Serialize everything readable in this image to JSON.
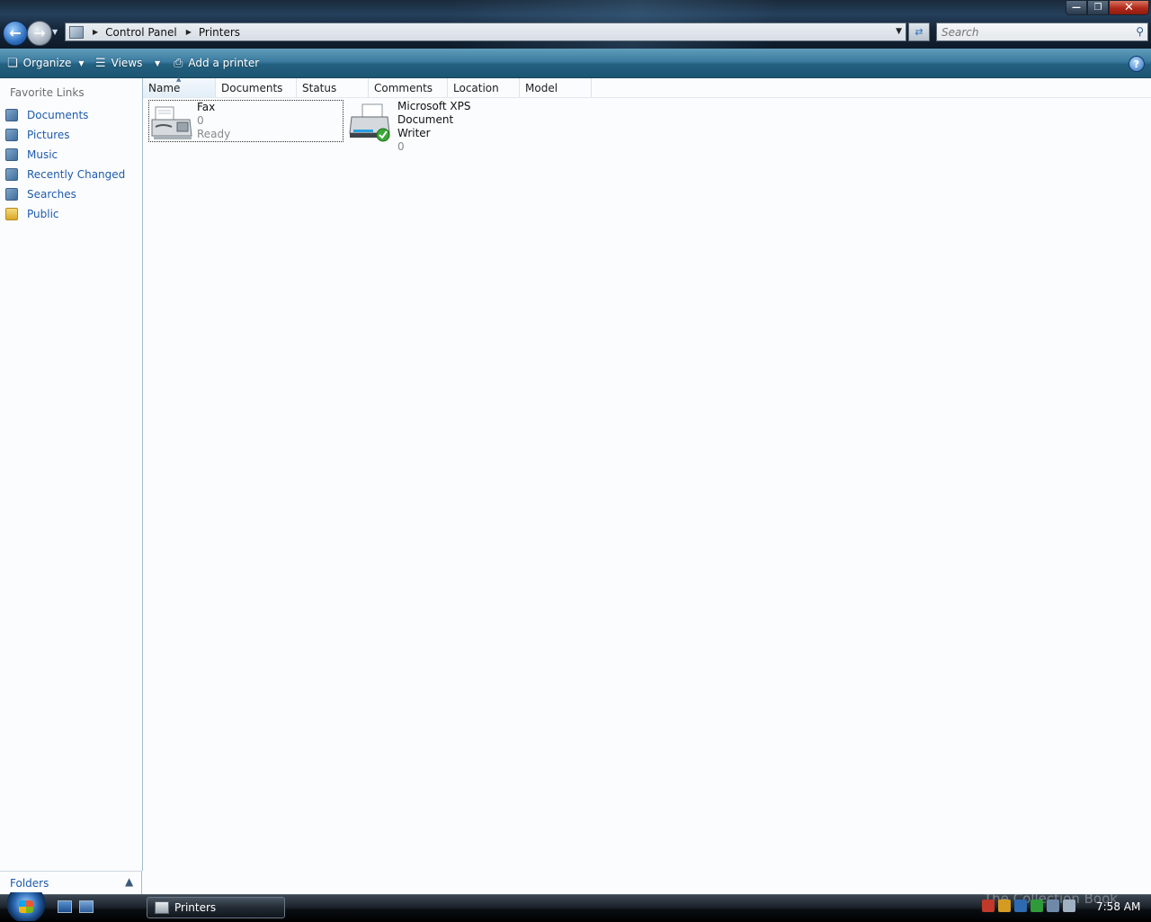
{
  "window": {
    "address_crumbs": [
      "Control Panel",
      "Printers"
    ],
    "search_placeholder": "Search"
  },
  "toolbar": {
    "organize_label": "Organize",
    "views_label": "Views",
    "add_printer_label": "Add a printer"
  },
  "navpane": {
    "heading": "Favorite Links",
    "links": [
      {
        "label": "Documents",
        "icon": "documents-icon"
      },
      {
        "label": "Pictures",
        "icon": "pictures-icon"
      },
      {
        "label": "Music",
        "icon": "music-icon"
      },
      {
        "label": "Recently Changed",
        "icon": "recently-changed-icon"
      },
      {
        "label": "Searches",
        "icon": "searches-icon"
      },
      {
        "label": "Public",
        "icon": "public-folder-icon"
      }
    ],
    "folders_label": "Folders"
  },
  "columns": [
    "Name",
    "Documents",
    "Status",
    "Comments",
    "Location",
    "Model"
  ],
  "printers": [
    {
      "name_line1": "Fax",
      "name_line2": "",
      "documents": "0",
      "status": "Ready",
      "icon": "fax-icon"
    },
    {
      "name_line1": "Microsoft XPS Document",
      "name_line2": "Writer",
      "documents": "0",
      "status": "",
      "icon": "default-printer-icon"
    }
  ],
  "taskbar": {
    "task_label": "Printers",
    "clock": "7:58 AM",
    "watermark": "The Collection Book"
  },
  "colors": {
    "link": "#1e5bad",
    "toolbar": "#3b7ba0",
    "muted_text": "#8a8a8a"
  }
}
